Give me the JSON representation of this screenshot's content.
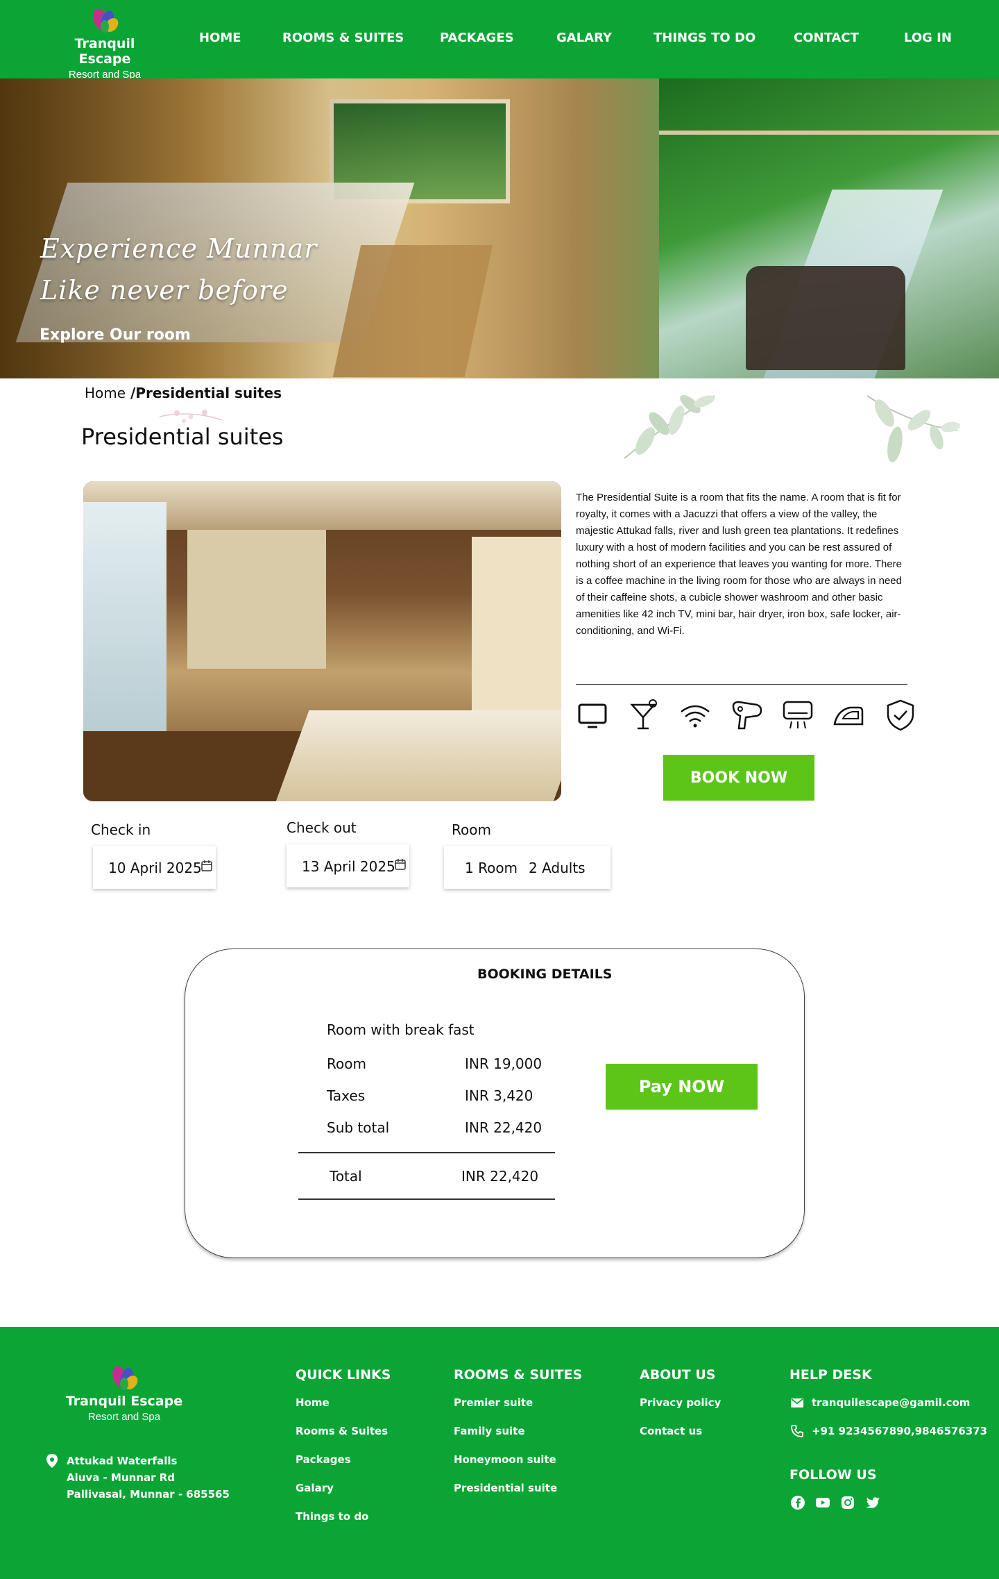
{
  "brand": {
    "name": "Tranquil Escape",
    "tagline": "Resort and Spa"
  },
  "nav": {
    "items": [
      "HOME",
      "ROOMS & SUITES",
      "PACKAGES",
      "GALARY",
      "THINGS TO DO",
      "CONTACT",
      "LOG IN"
    ]
  },
  "hero": {
    "line1": "Experience Munnar",
    "line2": "Like never before",
    "cta": "Explore Our room"
  },
  "breadcrumb": {
    "home": "Home",
    "separator": " /",
    "current": "Presidential suites"
  },
  "page_title": "Presidential suites",
  "room": {
    "description": "The Presidential Suite is a room that fits the name. A room that is fit for royalty, it comes with a Jacuzzi that offers a view of the valley, the majestic Attukad falls, river and lush green tea plantations. It redefines luxury with a host of modern facilities and you can be rest assured of nothing short of an experience that leaves you wanting for more. There is a coffee machine in the living room for those who are always in need of their caffeine shots, a cubicle shower washroom and other basic amenities like 42 inch TV, mini bar, hair dryer, iron box, safe locker, air-conditioning, and Wi-Fi.",
    "amenities": [
      "tv-icon",
      "cocktail-icon",
      "wifi-icon",
      "hair-dryer-icon",
      "air-conditioner-icon",
      "iron-icon",
      "safe-locker-icon"
    ],
    "book_label": "BOOK NOW"
  },
  "booking_form": {
    "checkin_label": "Check in",
    "checkin_value": "10 April 2025",
    "checkout_label": "Check out",
    "checkout_value": "13 April 2025",
    "room_label": "Room",
    "rooms_value": "1 Room",
    "guests_value": "2 Adults"
  },
  "booking_details": {
    "title": "BOOKING DETAILS",
    "plan": "Room with break fast",
    "rows": [
      {
        "label": "Room",
        "value": "INR 19,000"
      },
      {
        "label": "Taxes",
        "value": "INR 3,420"
      },
      {
        "label": "Sub total",
        "value": "INR 22,420"
      }
    ],
    "total_label": "Total",
    "total_value": "INR 22,420",
    "pay_label": "Pay NOW"
  },
  "footer": {
    "address": [
      "Attukad Waterfalls",
      "Aluva - Munnar Rd",
      "Pallivasal, Munnar - 685565"
    ],
    "quick_links": {
      "title": "QUICK LINKS",
      "items": [
        "Home",
        "Rooms & Suites",
        "Packages",
        "Galary",
        "Things to do"
      ]
    },
    "rooms": {
      "title": "ROOMS & SUITES",
      "items": [
        "Premier suite",
        "Family suite",
        "Honeymoon suite",
        "Presidential suite"
      ]
    },
    "about": {
      "title": "ABOUT US",
      "items": [
        "Privacy policy",
        "Contact us"
      ]
    },
    "help": {
      "title": "HELP DESK",
      "email": "tranquilescape@gamil.com",
      "phone": "+91 9234567890,9846576373"
    },
    "follow": {
      "title": "FOLLOW US",
      "icons": [
        "facebook-icon",
        "youtube-icon",
        "instagram-icon",
        "twitter-icon"
      ]
    }
  },
  "colors": {
    "brand_green": "#0aa535",
    "button_green": "#5cc518"
  }
}
